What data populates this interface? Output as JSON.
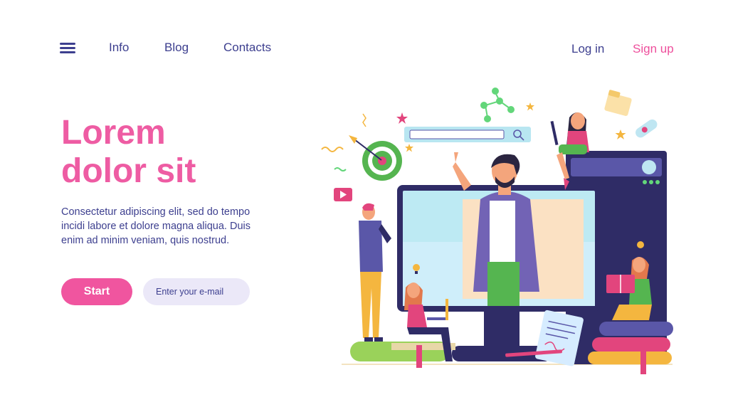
{
  "nav": {
    "menu_icon": "hamburger-menu-icon",
    "links": [
      "Info",
      "Blog",
      "Contacts"
    ],
    "login": "Log in",
    "signup": "Sign up"
  },
  "hero": {
    "title_line1": "Lorem",
    "title_line2": "dolor sit",
    "description": "Consectetur adipiscing elit, sed do tempo incidi labore et dolore magna aliqua. Duis enim ad minim veniam, quis nostrud."
  },
  "cta": {
    "start_label": "Start",
    "email_placeholder": "Enter your e-mail"
  },
  "colors": {
    "accent_pink": "#ee5ca3",
    "text_navy": "#3d3f8f",
    "input_bg": "#ebe8f8"
  },
  "illustration": {
    "icons": [
      "monitor",
      "teacher",
      "search-bar",
      "target",
      "video-play-icon",
      "molecule",
      "books",
      "notepad",
      "folder",
      "diploma",
      "lightbulb",
      "stars"
    ]
  }
}
